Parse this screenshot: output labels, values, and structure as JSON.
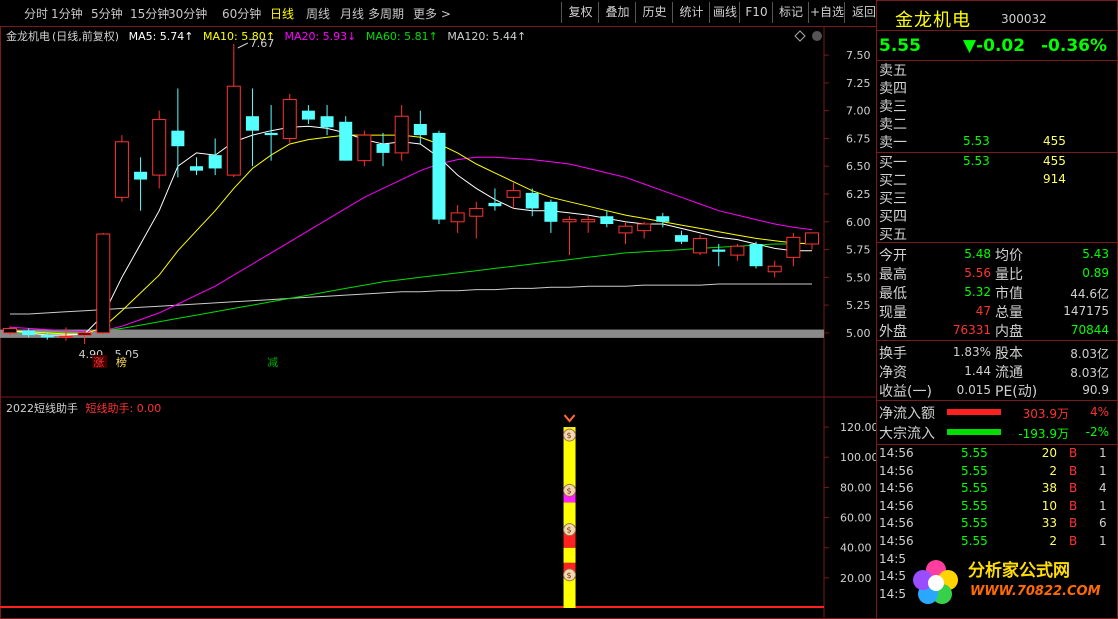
{
  "toolbar": {
    "periods": [
      "分时",
      "1分钟",
      "5分钟",
      "15分钟",
      "30分钟",
      "60分钟",
      "日线",
      "周线",
      "月线",
      "多周期",
      "更多 >"
    ],
    "active_period": "日线",
    "buttons": [
      "复权",
      "叠加",
      "历史",
      "统计",
      "画线",
      "F10",
      "标记",
      "+自选",
      "返回"
    ]
  },
  "legend": {
    "stock": "金龙机电",
    "mode": "(日线,前复权)",
    "ma5": "MA5: 5.74↑",
    "ma10": "MA10: 5.80↑",
    "ma20": "MA20: 5.93↓",
    "ma60": "MA60: 5.81↑",
    "ma120": "MA120: 5.44↑"
  },
  "colors": {
    "up": "#ff3232",
    "down": "#54ffff",
    "ma5": "#ffffff",
    "ma10": "#ffff00",
    "ma20": "#ff00ff",
    "ma60": "#00dd00",
    "ma120": "#cccccc",
    "grid": "#7a1a1a",
    "accent": "#ffff00"
  },
  "chart_data": [
    {
      "type": "candlestick",
      "title": "金龙机电(日线,前复权)",
      "ylim": [
        4.9,
        7.6
      ],
      "y_ticks": [
        "7.50",
        "7.25",
        "7.00",
        "6.75",
        "6.50",
        "6.25",
        "6.00",
        "5.75",
        "5.50",
        "5.25",
        "5.00"
      ],
      "annotations": {
        "high": "7.67",
        "low": "4.90",
        "low2": "5.05",
        "tags": [
          "涨",
          "榜",
          "减"
        ]
      },
      "candles": [
        {
          "o": 5.0,
          "h": 5.06,
          "l": 4.98,
          "c": 5.04
        },
        {
          "o": 5.02,
          "h": 5.04,
          "l": 4.96,
          "c": 4.98
        },
        {
          "o": 4.98,
          "h": 5.0,
          "l": 4.94,
          "c": 4.96
        },
        {
          "o": 4.96,
          "h": 5.05,
          "l": 4.93,
          "c": 4.97
        },
        {
          "o": 4.98,
          "h": 5.02,
          "l": 4.9,
          "c": 5.0
        },
        {
          "o": 5.0,
          "h": 5.9,
          "l": 4.99,
          "c": 5.89
        },
        {
          "o": 6.22,
          "h": 6.78,
          "l": 6.18,
          "c": 6.72
        },
        {
          "o": 6.45,
          "h": 6.58,
          "l": 6.1,
          "c": 6.38
        },
        {
          "o": 6.42,
          "h": 7.0,
          "l": 6.3,
          "c": 6.92
        },
        {
          "o": 6.82,
          "h": 7.2,
          "l": 6.4,
          "c": 6.68
        },
        {
          "o": 6.5,
          "h": 6.58,
          "l": 6.42,
          "c": 6.46
        },
        {
          "o": 6.6,
          "h": 6.75,
          "l": 6.42,
          "c": 6.48
        },
        {
          "o": 6.42,
          "h": 7.6,
          "l": 6.4,
          "c": 7.22
        },
        {
          "o": 6.95,
          "h": 7.2,
          "l": 6.5,
          "c": 6.82
        },
        {
          "o": 6.8,
          "h": 7.05,
          "l": 6.55,
          "c": 6.78
        },
        {
          "o": 6.75,
          "h": 7.15,
          "l": 6.7,
          "c": 7.1
        },
        {
          "o": 7.0,
          "h": 7.05,
          "l": 6.88,
          "c": 6.92
        },
        {
          "o": 6.95,
          "h": 7.05,
          "l": 6.78,
          "c": 6.85
        },
        {
          "o": 6.9,
          "h": 6.95,
          "l": 6.55,
          "c": 6.55
        },
        {
          "o": 6.55,
          "h": 6.82,
          "l": 6.5,
          "c": 6.78
        },
        {
          "o": 6.7,
          "h": 6.8,
          "l": 6.5,
          "c": 6.62
        },
        {
          "o": 6.62,
          "h": 7.05,
          "l": 6.55,
          "c": 6.95
        },
        {
          "o": 6.88,
          "h": 7.0,
          "l": 6.7,
          "c": 6.78
        },
        {
          "o": 6.8,
          "h": 6.82,
          "l": 5.98,
          "c": 6.02
        },
        {
          "o": 6.0,
          "h": 6.15,
          "l": 5.9,
          "c": 6.08
        },
        {
          "o": 6.05,
          "h": 6.18,
          "l": 5.85,
          "c": 6.12
        },
        {
          "o": 6.17,
          "h": 6.3,
          "l": 6.1,
          "c": 6.14
        },
        {
          "o": 6.22,
          "h": 6.35,
          "l": 6.12,
          "c": 6.28
        },
        {
          "o": 6.26,
          "h": 6.3,
          "l": 6.05,
          "c": 6.12
        },
        {
          "o": 6.18,
          "h": 6.2,
          "l": 5.9,
          "c": 6.0
        },
        {
          "o": 6.0,
          "h": 6.05,
          "l": 5.7,
          "c": 6.02
        },
        {
          "o": 6.0,
          "h": 6.05,
          "l": 5.9,
          "c": 6.02
        },
        {
          "o": 6.05,
          "h": 6.1,
          "l": 5.95,
          "c": 5.98
        },
        {
          "o": 5.9,
          "h": 6.0,
          "l": 5.8,
          "c": 5.96
        },
        {
          "o": 5.92,
          "h": 6.0,
          "l": 5.85,
          "c": 5.98
        },
        {
          "o": 6.05,
          "h": 6.08,
          "l": 5.95,
          "c": 6.0
        },
        {
          "o": 5.88,
          "h": 5.92,
          "l": 5.8,
          "c": 5.82
        },
        {
          "o": 5.72,
          "h": 5.88,
          "l": 5.7,
          "c": 5.85
        },
        {
          "o": 5.75,
          "h": 5.8,
          "l": 5.6,
          "c": 5.73
        },
        {
          "o": 5.7,
          "h": 5.8,
          "l": 5.65,
          "c": 5.78
        },
        {
          "o": 5.8,
          "h": 5.82,
          "l": 5.58,
          "c": 5.6
        },
        {
          "o": 5.55,
          "h": 5.65,
          "l": 5.5,
          "c": 5.6
        },
        {
          "o": 5.68,
          "h": 5.9,
          "l": 5.6,
          "c": 5.86
        },
        {
          "o": 5.8,
          "h": 5.9,
          "l": 5.75,
          "c": 5.9
        }
      ],
      "ma5": [
        5.02,
        5.0,
        4.98,
        4.98,
        4.99,
        5.16,
        5.5,
        5.8,
        6.1,
        6.5,
        6.62,
        6.6,
        6.72,
        6.78,
        6.82,
        6.85,
        6.86,
        6.84,
        6.8,
        6.74,
        6.7,
        6.72,
        6.7,
        6.58,
        6.42,
        6.3,
        6.2,
        6.12,
        6.1,
        6.1,
        6.08,
        6.06,
        6.03,
        6.0,
        5.98,
        5.98,
        5.94,
        5.9,
        5.86,
        5.84,
        5.8,
        5.76,
        5.74,
        5.74
      ],
      "ma10": [
        5.02,
        5.01,
        5.0,
        4.99,
        4.99,
        5.05,
        5.2,
        5.36,
        5.52,
        5.74,
        5.92,
        6.1,
        6.3,
        6.48,
        6.6,
        6.7,
        6.74,
        6.76,
        6.78,
        6.78,
        6.78,
        6.78,
        6.76,
        6.7,
        6.62,
        6.52,
        6.44,
        6.36,
        6.28,
        6.22,
        6.18,
        6.14,
        6.1,
        6.06,
        6.03,
        6.0,
        5.97,
        5.94,
        5.91,
        5.88,
        5.85,
        5.83,
        5.81,
        5.8
      ],
      "ma20": [
        5.05,
        5.04,
        5.03,
        5.02,
        5.01,
        5.02,
        5.06,
        5.12,
        5.18,
        5.26,
        5.34,
        5.42,
        5.52,
        5.62,
        5.72,
        5.82,
        5.92,
        6.02,
        6.12,
        6.22,
        6.3,
        6.38,
        6.46,
        6.52,
        6.56,
        6.58,
        6.58,
        6.57,
        6.56,
        6.54,
        6.52,
        6.48,
        6.44,
        6.4,
        6.34,
        6.28,
        6.22,
        6.16,
        6.1,
        6.06,
        6.02,
        5.98,
        5.95,
        5.93
      ],
      "ma60": [
        5.0,
        5.0,
        5.0,
        5.01,
        5.01,
        5.02,
        5.04,
        5.07,
        5.1,
        5.13,
        5.16,
        5.19,
        5.22,
        5.25,
        5.28,
        5.31,
        5.34,
        5.37,
        5.4,
        5.43,
        5.46,
        5.48,
        5.5,
        5.52,
        5.54,
        5.56,
        5.58,
        5.6,
        5.62,
        5.64,
        5.66,
        5.68,
        5.7,
        5.72,
        5.73,
        5.74,
        5.75,
        5.76,
        5.77,
        5.78,
        5.79,
        5.8,
        5.8,
        5.81
      ],
      "ma120": [
        5.17,
        5.17,
        5.18,
        5.19,
        5.2,
        5.21,
        5.22,
        5.23,
        5.24,
        5.25,
        5.26,
        5.27,
        5.28,
        5.29,
        5.3,
        5.31,
        5.32,
        5.33,
        5.34,
        5.35,
        5.36,
        5.37,
        5.37,
        5.38,
        5.38,
        5.39,
        5.39,
        5.4,
        5.4,
        5.41,
        5.41,
        5.42,
        5.42,
        5.42,
        5.43,
        5.43,
        5.43,
        5.43,
        5.44,
        5.44,
        5.44,
        5.44,
        5.44,
        5.44
      ]
    },
    {
      "type": "bar",
      "title": "2022短线助手",
      "series_label": "短线助手: 0.00",
      "ylim": [
        0,
        130
      ],
      "y_ticks": [
        "120.00",
        "100.00",
        "80.00",
        "60.00",
        "40.00",
        "20.00"
      ],
      "signal_index": 30,
      "signal_value": 120,
      "segments": [
        {
          "from": 0,
          "to": 20,
          "color": "#ffff00"
        },
        {
          "from": 20,
          "to": 30,
          "color": "#ff2020"
        },
        {
          "from": 30,
          "to": 40,
          "color": "#ffff00"
        },
        {
          "from": 40,
          "to": 50,
          "color": "#ff2020"
        },
        {
          "from": 50,
          "to": 70,
          "color": "#ffff00"
        },
        {
          "from": 70,
          "to": 80,
          "color": "#ff20ff"
        },
        {
          "from": 80,
          "to": 120,
          "color": "#ffff00"
        }
      ]
    }
  ],
  "quote": {
    "name": "金龙机电",
    "code": "300032",
    "price": "5.55",
    "change": "▼-0.02",
    "pct": "-0.36%",
    "sells": [
      {
        "label": "卖五",
        "price": "",
        "vol": ""
      },
      {
        "label": "卖四",
        "price": "",
        "vol": ""
      },
      {
        "label": "卖三",
        "price": "",
        "vol": ""
      },
      {
        "label": "卖二",
        "price": "",
        "vol": ""
      },
      {
        "label": "卖一",
        "price": "5.53",
        "vol": "455"
      }
    ],
    "buys": [
      {
        "label": "买一",
        "price": "5.53",
        "vol": "455"
      },
      {
        "label": "买二",
        "price": "",
        "vol": "914"
      },
      {
        "label": "买三",
        "price": "",
        "vol": ""
      },
      {
        "label": "买四",
        "price": "",
        "vol": ""
      },
      {
        "label": "买五",
        "price": "",
        "vol": ""
      }
    ],
    "stats_left": [
      {
        "label": "今开",
        "value": "5.48",
        "color": "#00ff00"
      },
      {
        "label": "最高",
        "value": "5.56",
        "color": "#ff3232"
      },
      {
        "label": "最低",
        "value": "5.32",
        "color": "#00ff00"
      },
      {
        "label": "现量",
        "value": "47",
        "color": "#ff3232"
      },
      {
        "label": "外盘",
        "value": "76331",
        "color": "#ff3232"
      }
    ],
    "stats_right": [
      {
        "label": "均价",
        "value": "5.43",
        "color": "#00ff00"
      },
      {
        "label": "量比",
        "value": "0.89",
        "color": "#00ff00"
      },
      {
        "label": "市值",
        "value": "44.6亿",
        "color": "#d0d0d0"
      },
      {
        "label": "总量",
        "value": "147175",
        "color": "#d0d0d0"
      },
      {
        "label": "内盘",
        "value": "70844",
        "color": "#00ff00"
      }
    ],
    "stats2_left": [
      {
        "label": "换手",
        "value": "1.83%"
      },
      {
        "label": "净资",
        "value": "1.44"
      },
      {
        "label": "收益(一)",
        "value": "0.015"
      }
    ],
    "stats2_right": [
      {
        "label": "股本",
        "value": "8.03亿"
      },
      {
        "label": "流通",
        "value": "8.03亿"
      },
      {
        "label": "PE(动)",
        "value": "90.9"
      }
    ],
    "flows": [
      {
        "label": "净流入额",
        "value": "303.9万",
        "pct": "4%",
        "color": "#ff2020",
        "valcolor": "#ff3232"
      },
      {
        "label": "大宗流入",
        "value": "-193.9万",
        "pct": "-2%",
        "color": "#00dd00",
        "valcolor": "#00ff00"
      }
    ],
    "ticks": [
      {
        "time": "14:56",
        "price": "5.55",
        "vol": "20",
        "side": "B",
        "n": "1"
      },
      {
        "time": "14:56",
        "price": "5.55",
        "vol": "2",
        "side": "B",
        "n": "1"
      },
      {
        "time": "14:56",
        "price": "5.55",
        "vol": "38",
        "side": "B",
        "n": "4"
      },
      {
        "time": "14:56",
        "price": "5.55",
        "vol": "10",
        "side": "B",
        "n": "1"
      },
      {
        "time": "14:56",
        "price": "5.55",
        "vol": "33",
        "side": "B",
        "n": "6"
      },
      {
        "time": "14:56",
        "price": "5.55",
        "vol": "2",
        "side": "B",
        "n": "1"
      },
      {
        "time": "14:5",
        "price": "",
        "vol": "",
        "side": "",
        "n": ""
      },
      {
        "time": "14:5",
        "price": "",
        "vol": "",
        "side": "",
        "n": ""
      },
      {
        "time": "14:5",
        "price": "",
        "vol": "",
        "side": "",
        "n": ""
      }
    ]
  },
  "logo": {
    "text": "分析家公式网",
    "url": "WWW.70822.COM"
  }
}
